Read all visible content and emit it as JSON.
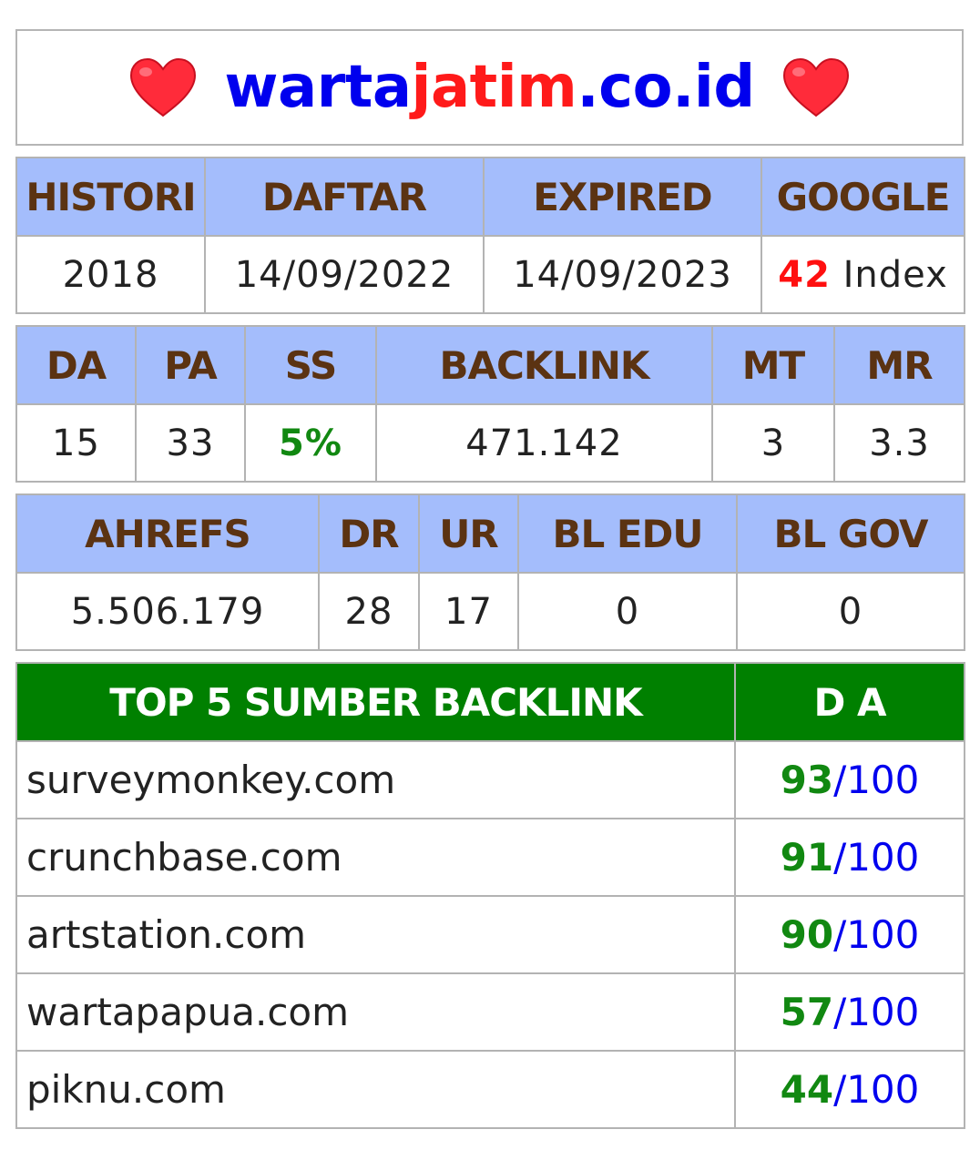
{
  "title": {
    "part1": "warta",
    "part2": "jatim",
    "part3": ".co.id",
    "heart_icon": "heart-icon"
  },
  "colors": {
    "header_bg": "#a4bdfc",
    "header_text": "#5b3312",
    "green_header": "#008000",
    "accent_red": "#ff1010",
    "accent_green": "#118811",
    "link_blue": "#0000ee"
  },
  "table1": {
    "headers": [
      "HISTORI",
      "DAFTAR",
      "EXPIRED",
      "GOOGLE"
    ],
    "histori": "2018",
    "daftar": "14/09/2022",
    "expired": "14/09/2023",
    "google_count": "42",
    "google_label": "Index"
  },
  "table2": {
    "headers": [
      "DA",
      "PA",
      "SS",
      "BACKLINK",
      "MT",
      "MR"
    ],
    "values": [
      "15",
      "33",
      "5%",
      "471.142",
      "3",
      "3.3"
    ]
  },
  "table3": {
    "headers": [
      "AHREFS",
      "DR",
      "UR",
      "BL EDU",
      "BL GOV"
    ],
    "values": [
      "5.506.179",
      "28",
      "17",
      "0",
      "0"
    ]
  },
  "backlinks": {
    "headers": [
      "TOP 5 SUMBER BACKLINK",
      "D A"
    ],
    "rows": [
      {
        "domain": "surveymonkey.com",
        "da": "93",
        "max": "/100"
      },
      {
        "domain": "crunchbase.com",
        "da": "91",
        "max": "/100"
      },
      {
        "domain": "artstation.com",
        "da": "90",
        "max": "/100"
      },
      {
        "domain": "wartapapua.com",
        "da": "57",
        "max": "/100"
      },
      {
        "domain": "piknu.com",
        "da": "44",
        "max": "/100"
      }
    ]
  }
}
